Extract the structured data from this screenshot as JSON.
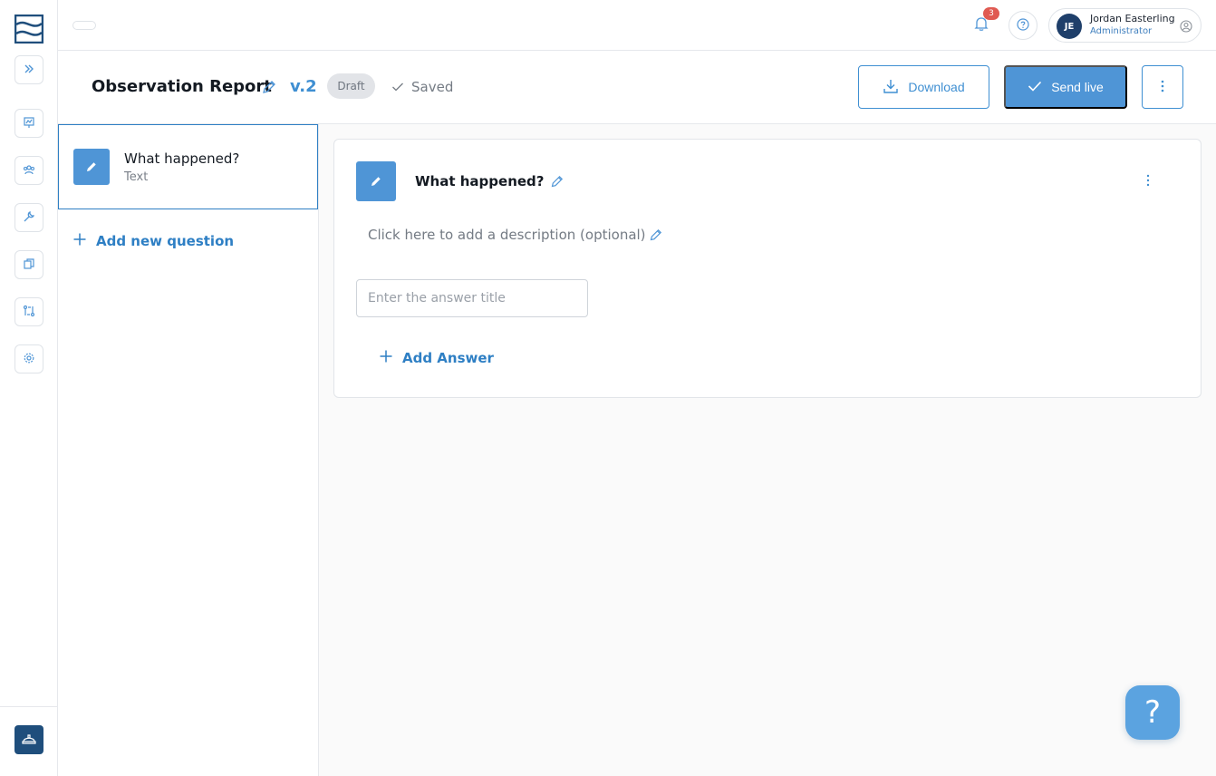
{
  "colors": {
    "accent": "#3f8fd2",
    "primary_button": "#4f95d6",
    "navy": "#1f3f6a",
    "badge": "#e05a52"
  },
  "sidebar": {
    "items": [
      {
        "name": "expand",
        "icon": "chevrons-right-icon"
      },
      {
        "name": "presentation",
        "icon": "presentation-chart-icon"
      },
      {
        "name": "team",
        "icon": "team-icon"
      },
      {
        "name": "tools",
        "icon": "wrench-icon"
      },
      {
        "name": "documents",
        "icon": "copy-documents-icon"
      },
      {
        "name": "workflow",
        "icon": "workflow-icon"
      },
      {
        "name": "settings",
        "icon": "gear-icon"
      }
    ],
    "bottom_icon": "hard-hat-icon"
  },
  "header": {
    "notifications_count": "3",
    "user": {
      "initials": "JE",
      "name": "Jordan Easterling",
      "role": "Administrator"
    }
  },
  "form": {
    "title": "Observation Report",
    "version": "v.2",
    "status": "Draft",
    "save_state": "Saved",
    "download_label": "Download",
    "send_live_label": "Send live"
  },
  "questions": [
    {
      "title": "What happened?",
      "type": "Text"
    }
  ],
  "add_question_label": "Add new question",
  "editor": {
    "question_title": "What happened?",
    "description_placeholder": "Click here to add a description (optional)",
    "answer_placeholder": "Enter the answer title",
    "add_answer_label": "Add Answer"
  },
  "help_fab": "?"
}
